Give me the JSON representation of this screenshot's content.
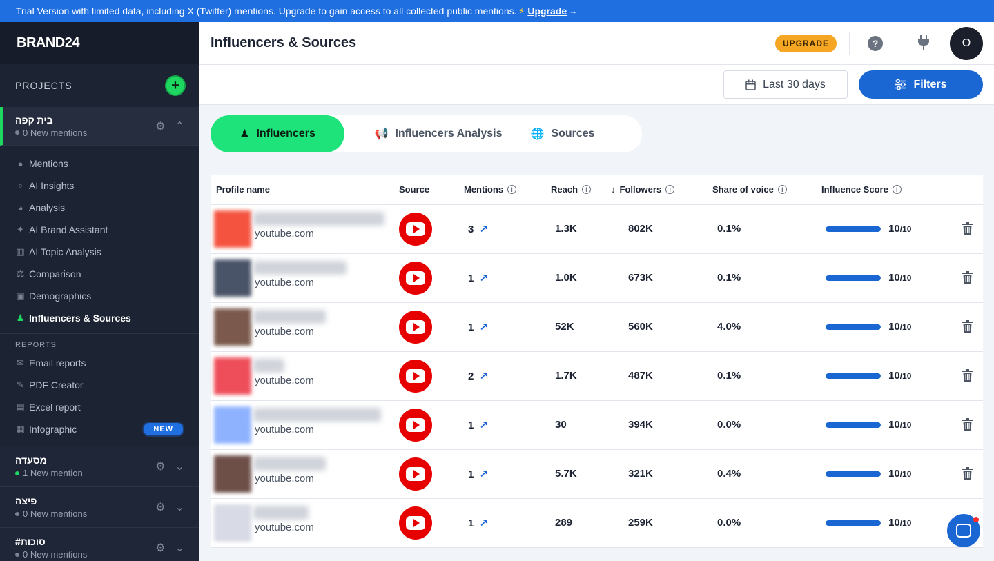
{
  "banner": {
    "text": "Trial Version with limited data, including X (Twitter) mentions. Upgrade to gain access to all collected public mentions.",
    "link": "Upgrade"
  },
  "sidebar": {
    "logo": "BRAND24",
    "projects_label": "PROJECTS",
    "active_project": {
      "name": "בית קפה",
      "sub": "0 New mentions"
    },
    "nav": [
      {
        "label": "Mentions",
        "icon": "chat-icon"
      },
      {
        "label": "AI Insights",
        "icon": "ai-search-icon"
      },
      {
        "label": "Analysis",
        "icon": "pie-icon"
      },
      {
        "label": "AI Brand Assistant",
        "icon": "sparkle-icon"
      },
      {
        "label": "AI Topic Analysis",
        "icon": "chart-icon"
      },
      {
        "label": "Comparison",
        "icon": "scale-icon"
      },
      {
        "label": "Demographics",
        "icon": "demographics-icon"
      },
      {
        "label": "Influencers & Sources",
        "icon": "influencer-icon"
      }
    ],
    "reports_label": "REPORTS",
    "reports": [
      {
        "label": "Email reports",
        "icon": "mail-icon"
      },
      {
        "label": "PDF Creator",
        "icon": "pdf-icon"
      },
      {
        "label": "Excel report",
        "icon": "excel-icon"
      },
      {
        "label": "Infographic",
        "icon": "infographic-icon",
        "badge": "NEW"
      }
    ],
    "other_projects": [
      {
        "name": "מסעדה",
        "sub": "1 New mention",
        "status": "green"
      },
      {
        "name": "פיצה",
        "sub": "0 New mentions",
        "status": "gray"
      },
      {
        "name": "#סוכות",
        "sub": "0 New mentions",
        "status": "gray"
      }
    ]
  },
  "header": {
    "title": "Influencers & Sources",
    "upgrade": "UPGRADE",
    "avatar_initial": "O"
  },
  "filterbar": {
    "date": "Last 30 days",
    "filters": "Filters"
  },
  "tabs": [
    {
      "label": "Influencers",
      "icon": "influencer-icon"
    },
    {
      "label": "Influencers Analysis",
      "icon": "megaphone-icon"
    },
    {
      "label": "Sources",
      "icon": "globe-icon"
    }
  ],
  "table": {
    "columns": [
      "Profile name",
      "Source",
      "Mentions",
      "Reach",
      "Followers",
      "Share of voice",
      "Influence Score"
    ],
    "rows": [
      {
        "domain": "youtube.com",
        "mentions": "3",
        "reach": "1.3K",
        "followers": "802K",
        "sov": "0.1%",
        "score": "10",
        "score_max": "/10",
        "score_fraction": 1.0,
        "avatar_color": "#f4533f"
      },
      {
        "domain": "youtube.com",
        "mentions": "1",
        "reach": "1.0K",
        "followers": "673K",
        "sov": "0.1%",
        "score": "10",
        "score_max": "/10",
        "score_fraction": 1.0,
        "avatar_color": "#4a5468"
      },
      {
        "domain": "youtube.com",
        "mentions": "1",
        "reach": "52K",
        "followers": "560K",
        "sov": "4.0%",
        "score": "10",
        "score_max": "/10",
        "score_fraction": 1.0,
        "avatar_color": "#7b5a4d"
      },
      {
        "domain": "youtube.com",
        "mentions": "2",
        "reach": "1.7K",
        "followers": "487K",
        "sov": "0.1%",
        "score": "10",
        "score_max": "/10",
        "score_fraction": 1.0,
        "avatar_color": "#ee4e5a"
      },
      {
        "domain": "youtube.com",
        "mentions": "1",
        "reach": "30",
        "followers": "394K",
        "sov": "0.0%",
        "score": "10",
        "score_max": "/10",
        "score_fraction": 1.0,
        "avatar_color": "#8fb2ff"
      },
      {
        "domain": "youtube.com",
        "mentions": "1",
        "reach": "5.7K",
        "followers": "321K",
        "sov": "0.4%",
        "score": "10",
        "score_max": "/10",
        "score_fraction": 1.0,
        "avatar_color": "#6e4f48"
      },
      {
        "domain": "youtube.com",
        "mentions": "1",
        "reach": "289",
        "followers": "259K",
        "sov": "0.0%",
        "score": "10",
        "score_max": "/10",
        "score_fraction": 1.0,
        "avatar_color": "#d8dbe6"
      }
    ]
  }
}
